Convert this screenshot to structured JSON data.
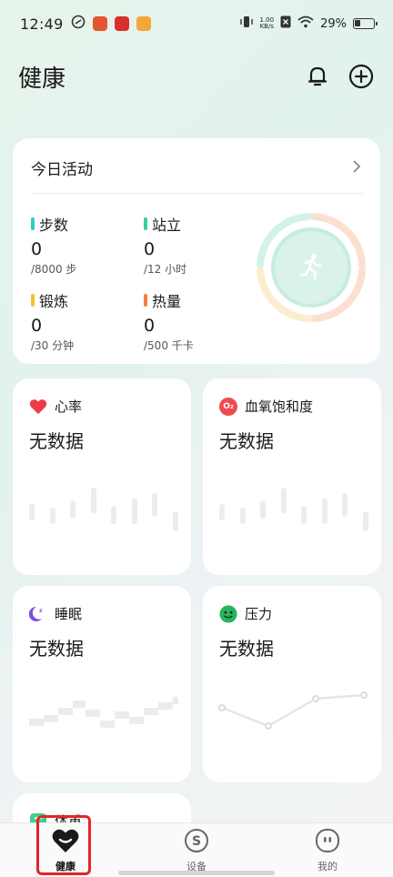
{
  "status": {
    "time": "12:49",
    "net_speed_value": "1.00",
    "net_speed_unit": "KB/s",
    "battery": "29%"
  },
  "header": {
    "title": "健康"
  },
  "activity": {
    "title": "今日活动",
    "metrics": [
      {
        "label": "步数",
        "value": "0",
        "goal": "/8000 步",
        "color": "#37c9c3"
      },
      {
        "label": "站立",
        "value": "0",
        "goal": "/12 小时",
        "color": "#3fcf8e"
      },
      {
        "label": "锻炼",
        "value": "0",
        "goal": "/30 分钟",
        "color": "#f2c230"
      },
      {
        "label": "热量",
        "value": "0",
        "goal": "/500 千卡",
        "color": "#f0803a"
      }
    ]
  },
  "cards": {
    "heart_rate": {
      "title": "心率",
      "status": "无数据"
    },
    "spo2": {
      "title": "血氧饱和度",
      "status": "无数据",
      "icon_text": "O₂"
    },
    "sleep": {
      "title": "睡眠",
      "status": "无数据"
    },
    "stress": {
      "title": "压力",
      "status": "无数据"
    },
    "weight": {
      "title": "体重"
    }
  },
  "nav": {
    "items": [
      {
        "label": "健康",
        "icon": "heart-icon",
        "active": true
      },
      {
        "label": "设备",
        "icon": "device-icon",
        "active": false
      },
      {
        "label": "我的",
        "icon": "profile-icon",
        "active": false
      }
    ]
  },
  "colors": {
    "accent_red": "#e5232b",
    "ring_teal": "#3cc9a8"
  }
}
